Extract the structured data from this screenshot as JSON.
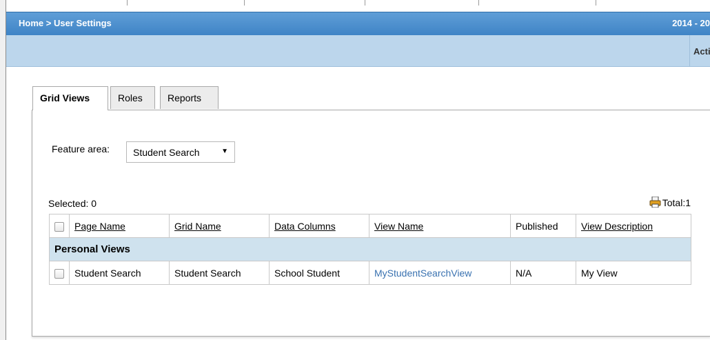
{
  "header": {
    "breadcrumb_home": "Home",
    "breadcrumb_sep": " > ",
    "breadcrumb_current": "User Settings",
    "year": "2014 - 20",
    "action_label": "Acti"
  },
  "tabs": [
    {
      "label": "Grid Views",
      "active": true
    },
    {
      "label": "Roles",
      "active": false
    },
    {
      "label": "Reports",
      "active": false
    }
  ],
  "filter": {
    "label": "Feature area:",
    "value": "Student Search"
  },
  "summary": {
    "selected": "Selected: 0",
    "total": "Total:1"
  },
  "table": {
    "columns": [
      "Page Name",
      "Grid Name",
      "Data Columns",
      "View Name",
      "Published",
      "View Description"
    ],
    "group_label": "Personal Views",
    "rows": [
      {
        "page_name": "Student Search",
        "grid_name": "Student Search",
        "data_columns": "School Student",
        "view_name": "MyStudentSearchView",
        "published": "N/A",
        "view_description": "My View"
      }
    ]
  },
  "colors": {
    "header_blue": "#4a8fd0",
    "subbar_blue": "#bcd6ec",
    "group_row": "#cfe2ee",
    "link": "#3a72b0"
  }
}
